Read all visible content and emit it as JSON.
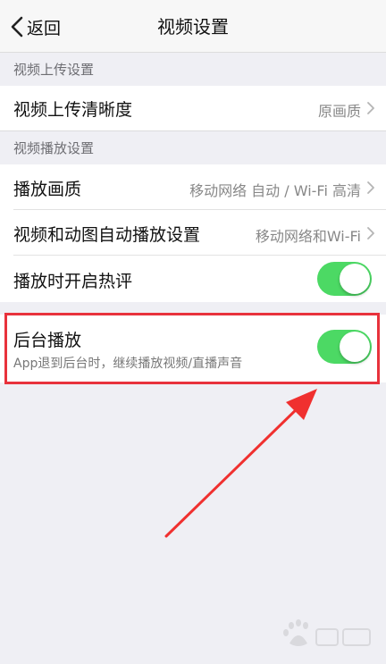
{
  "nav": {
    "back_label": "返回",
    "title": "视频设置"
  },
  "sections": {
    "upload": {
      "header": "视频上传设置",
      "rows": [
        {
          "label": "视频上传清晰度",
          "value": "原画质"
        }
      ]
    },
    "playback": {
      "header": "视频播放设置",
      "rows": [
        {
          "label": "播放画质",
          "value": "移动网络 自动 / Wi-Fi 高清"
        },
        {
          "label": "视频和动图自动播放设置",
          "value": "移动网络和Wi-Fi"
        },
        {
          "label": "播放时开启热评",
          "toggle_on": true
        }
      ]
    },
    "background": {
      "label": "后台播放",
      "subtitle": "App退到后台时，继续播放视频/直播声音",
      "toggle_on": true
    }
  },
  "colors": {
    "toggle_on": "#4cd964",
    "annotation": "#e8323c",
    "background": "#efeff4"
  }
}
